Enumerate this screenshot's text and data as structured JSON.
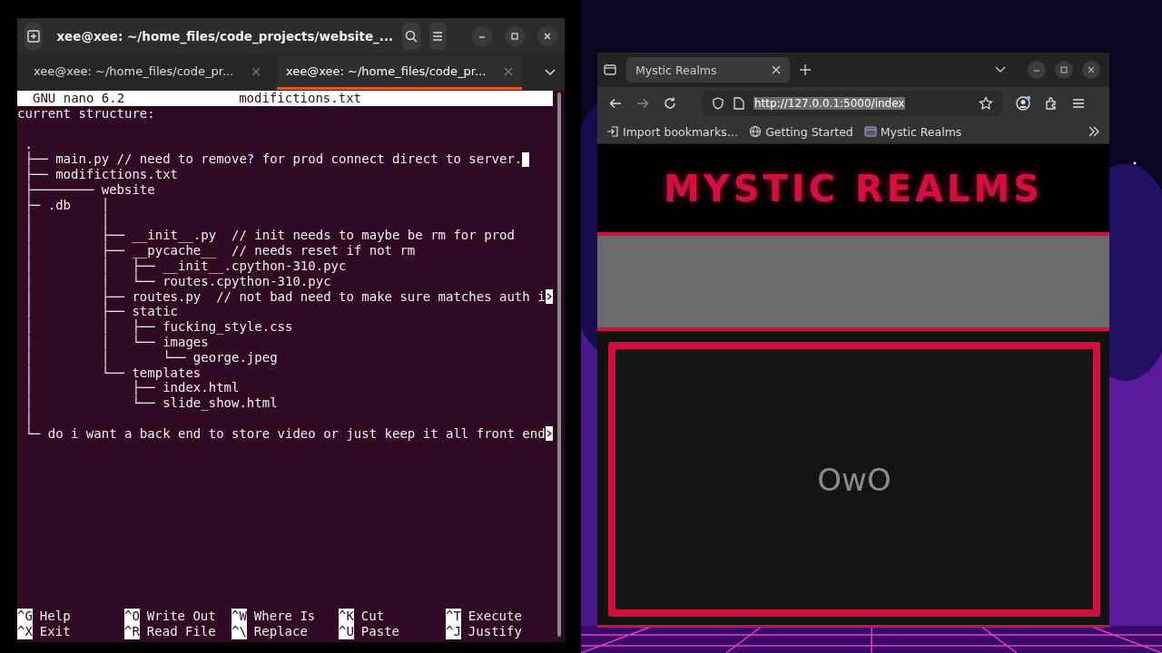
{
  "terminal": {
    "title": "xee@xee: ~/home_files/code_projects/website_...",
    "tabs": [
      {
        "label": "xee@xee: ~/home_files/code_pr...",
        "selected": false
      },
      {
        "label": "xee@xee: ~/home_files/code_pr...",
        "selected": true
      }
    ],
    "nano": {
      "version": "GNU nano 6.2",
      "filename": "modifictions.txt",
      "lines": [
        {
          "text": "current structure:",
          "blank_after": true
        },
        {
          "text": " ."
        },
        {
          "text": " ├── main.py // need to remove? for prod connect direct to server.",
          "cursor": true
        },
        {
          "text": " ├── modifictions.txt"
        },
        {
          "text": " ├──────── website"
        },
        {
          "text": " ├─ .db    │"
        },
        {
          "text": " │         │"
        },
        {
          "text": " │         ├── __init__.py  // init needs to maybe be rm for prod"
        },
        {
          "text": " │         ├── __pycache__  // needs reset if not rm"
        },
        {
          "text": " │         │   ├── __init__.cpython-310.pyc"
        },
        {
          "text": " │         │   └── routes.cpython-310.pyc"
        },
        {
          "text": " │         ├── routes.py  // not bad need to make sure matches auth i",
          "overflow": true
        },
        {
          "text": " │         ├── static"
        },
        {
          "text": " │         │   ├── fucking_style.css"
        },
        {
          "text": " │         │   └── images"
        },
        {
          "text": " │         │       └── george.jpeg"
        },
        {
          "text": " │         └── templates"
        },
        {
          "text": " │             ├── index.html"
        },
        {
          "text": " │             └── slide_show.html"
        },
        {
          "text": " │"
        },
        {
          "text": " └─ do i want a back end to store video or just keep it all front end",
          "overflow": true
        }
      ],
      "shortcuts": [
        {
          "key": "^G",
          "label": "Help"
        },
        {
          "key": "^O",
          "label": "Write Out"
        },
        {
          "key": "^W",
          "label": "Where Is"
        },
        {
          "key": "^K",
          "label": "Cut"
        },
        {
          "key": "^T",
          "label": "Execute"
        },
        {
          "key": "^X",
          "label": "Exit"
        },
        {
          "key": "^R",
          "label": "Read File"
        },
        {
          "key": "^\\",
          "label": "Replace"
        },
        {
          "key": "^U",
          "label": "Paste"
        },
        {
          "key": "^J",
          "label": "Justify"
        }
      ]
    }
  },
  "browser": {
    "tabs": [
      {
        "label": "Mystic Realms",
        "selected": true
      }
    ],
    "url": "http://127.0.0.1:5000/index",
    "bookmarks": [
      {
        "label": "Import bookmarks…",
        "kind": "import"
      },
      {
        "label": "Getting Started",
        "kind": "globe"
      },
      {
        "label": "Mystic Realms",
        "kind": "site"
      }
    ],
    "page": {
      "heading": "MYSTIC REALMS",
      "card_text": "OwO"
    }
  }
}
